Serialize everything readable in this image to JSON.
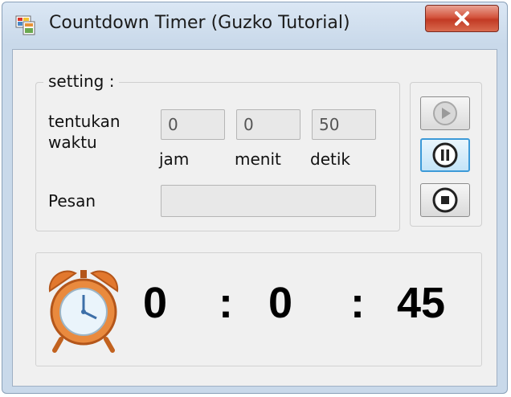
{
  "window": {
    "title": "Countdown Timer (Guzko Tutorial)",
    "close_icon": "close-icon"
  },
  "setting": {
    "group_title": "setting :",
    "duration_label_line1": "tentukan",
    "duration_label_line2": "waktu",
    "hours_value": "0",
    "minutes_value": "0",
    "seconds_value": "50",
    "hours_label": "jam",
    "minutes_label": "menit",
    "seconds_label": "detik",
    "message_label": "Pesan",
    "message_value": ""
  },
  "controls": {
    "play_icon": "play-icon",
    "pause_icon": "pause-icon",
    "stop_icon": "stop-icon"
  },
  "display": {
    "clock_icon": "alarm-clock-icon",
    "hours": "0",
    "sep1": ":",
    "minutes": "0",
    "sep2": ":",
    "seconds": "45"
  },
  "colors": {
    "title_bar": "#c9d9ea",
    "close_button": "#c9452c",
    "client_background": "#f0f0f0",
    "clock_body": "#e2782e",
    "focus_border": "#3c9ad8"
  }
}
